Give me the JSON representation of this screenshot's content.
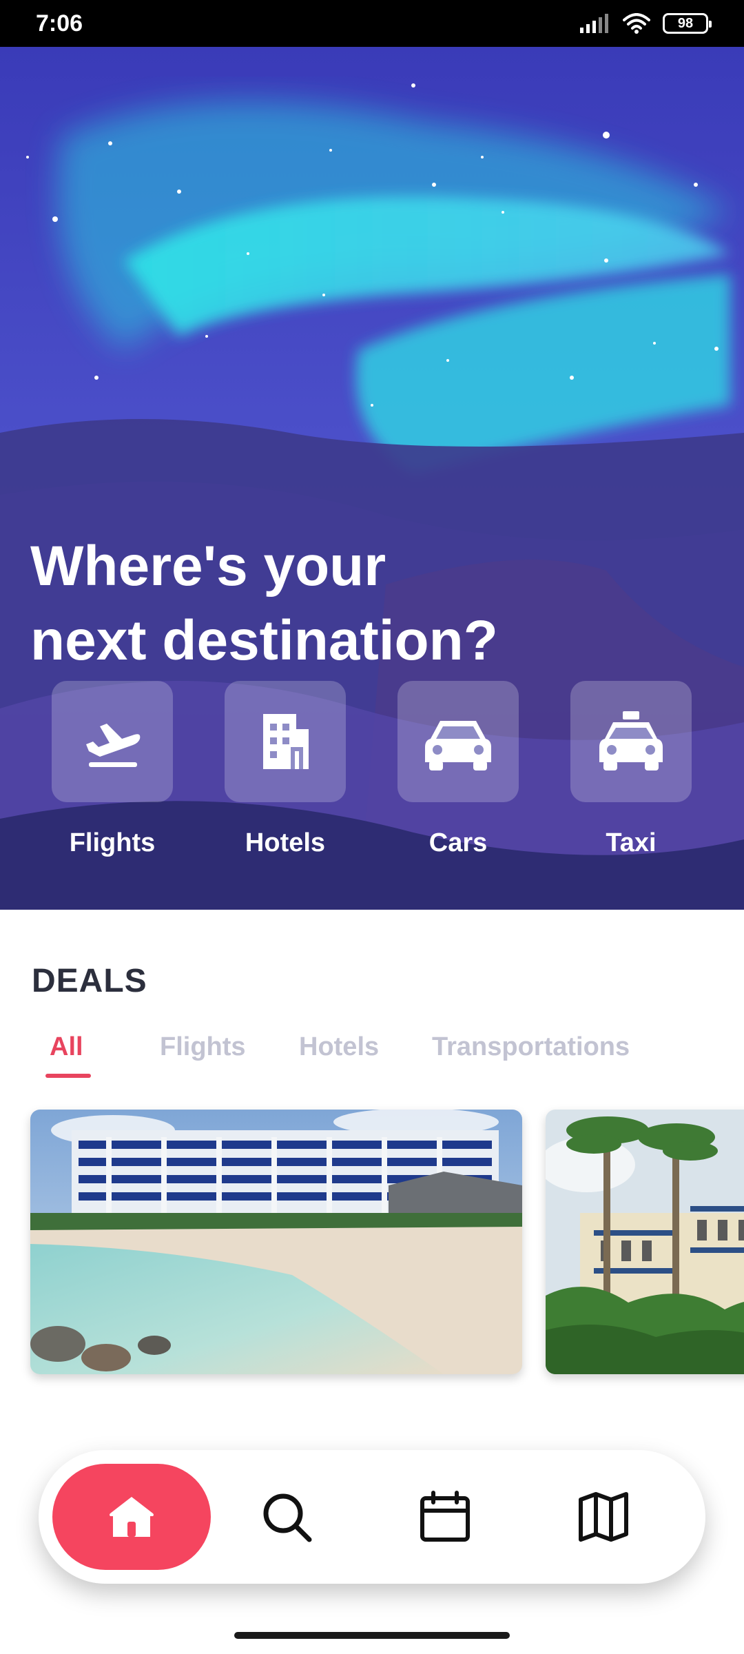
{
  "status_bar": {
    "time": "7:06",
    "battery": "98",
    "icons": [
      "signal-icon",
      "wifi-icon",
      "battery-icon"
    ]
  },
  "hero": {
    "title_line1": "Where's your",
    "title_line2": "next destination?",
    "categories": [
      {
        "label": "Flights",
        "icon": "airplane-icon"
      },
      {
        "label": "Hotels",
        "icon": "hotel-icon"
      },
      {
        "label": "Cars",
        "icon": "car-icon"
      },
      {
        "label": "Taxi",
        "icon": "taxi-icon"
      }
    ]
  },
  "deals": {
    "title": "DEALS",
    "tabs": [
      "All",
      "Flights",
      "Hotels",
      "Transportations"
    ],
    "active_tab": "All",
    "cards": [
      {
        "image": "beach-resort-photo"
      },
      {
        "image": "palm-villa-photo"
      }
    ]
  },
  "bottom_nav": {
    "items": [
      {
        "icon": "home-icon",
        "active": true
      },
      {
        "icon": "search-icon",
        "active": false
      },
      {
        "icon": "calendar-icon",
        "active": false
      },
      {
        "icon": "map-icon",
        "active": false
      }
    ]
  },
  "colors": {
    "accent": "#f5455f",
    "tab_active": "#e8445e",
    "tab_inactive": "#c2c3d2",
    "heading": "#2c2f3d"
  }
}
